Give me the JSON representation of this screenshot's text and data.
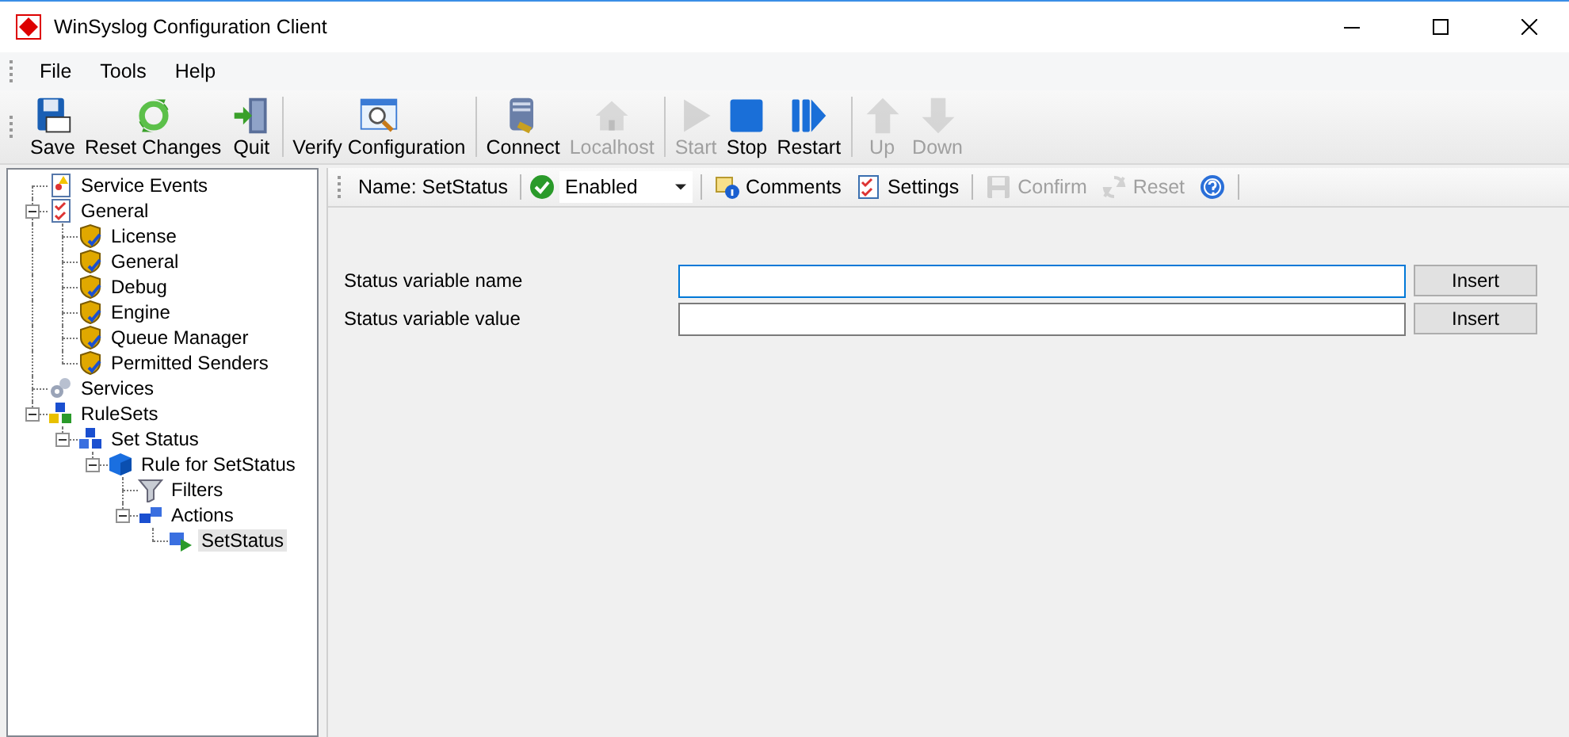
{
  "window": {
    "title": "WinSyslog Configuration Client"
  },
  "menu": [
    {
      "label": "File"
    },
    {
      "label": "Tools"
    },
    {
      "label": "Help"
    }
  ],
  "toolbar": {
    "groups": [
      [
        {
          "kind": "save",
          "label": "Save",
          "disabled": false
        },
        {
          "kind": "reset",
          "label": "Reset Changes",
          "disabled": false
        },
        {
          "kind": "quit",
          "label": "Quit",
          "disabled": false
        }
      ],
      [
        {
          "kind": "verify",
          "label": "Verify Configuration",
          "disabled": false
        }
      ],
      [
        {
          "kind": "connect",
          "label": "Connect",
          "disabled": false
        },
        {
          "kind": "localhost",
          "label": "Localhost",
          "disabled": true
        }
      ],
      [
        {
          "kind": "start",
          "label": "Start",
          "disabled": true
        },
        {
          "kind": "stop",
          "label": "Stop",
          "disabled": false
        },
        {
          "kind": "restart",
          "label": "Restart",
          "disabled": false
        }
      ],
      [
        {
          "kind": "up",
          "label": "Up",
          "disabled": true
        },
        {
          "kind": "down",
          "label": "Down",
          "disabled": true
        }
      ]
    ]
  },
  "tree": [
    {
      "kind": "events",
      "label": "Service Events",
      "selected": false
    },
    {
      "kind": "settings",
      "label": "General",
      "selected": false,
      "expanded": true,
      "children": [
        {
          "kind": "module",
          "label": "License",
          "selected": false
        },
        {
          "kind": "module",
          "label": "General",
          "selected": false
        },
        {
          "kind": "module",
          "label": "Debug",
          "selected": false
        },
        {
          "kind": "module",
          "label": "Engine",
          "selected": false
        },
        {
          "kind": "module",
          "label": "Queue Manager",
          "selected": false
        },
        {
          "kind": "module",
          "label": "Permitted Senders",
          "selected": false
        }
      ]
    },
    {
      "kind": "services",
      "label": "Services",
      "selected": false
    },
    {
      "kind": "rulesets",
      "label": "RuleSets",
      "selected": false,
      "expanded": true,
      "children": [
        {
          "kind": "ruleset",
          "label": "Set Status",
          "selected": false,
          "expanded": true,
          "children": [
            {
              "kind": "rule",
              "label": "Rule for SetStatus",
              "selected": false,
              "expanded": true,
              "children": [
                {
                  "kind": "filters",
                  "label": "Filters",
                  "selected": false
                },
                {
                  "kind": "actions",
                  "label": "Actions",
                  "selected": false,
                  "expanded": true,
                  "children": [
                    {
                      "kind": "action",
                      "label": "SetStatus",
                      "selected": true
                    }
                  ]
                }
              ]
            }
          ]
        }
      ]
    }
  ],
  "rule_bar": {
    "name": "Name: SetStatus",
    "status": "Enabled",
    "groups": [
      [
        {
          "kind": "comments",
          "label": "Comments",
          "disabled": false
        },
        {
          "kind": "settings",
          "label": "Settings",
          "disabled": false
        }
      ],
      [
        {
          "kind": "confirm",
          "label": "Confirm",
          "disabled": true
        },
        {
          "kind": "reset",
          "label": "Reset",
          "disabled": true
        },
        {
          "kind": "help"
        }
      ]
    ]
  },
  "fields": [
    {
      "label": "Status variable name",
      "focused": true,
      "button": "Insert"
    },
    {
      "label": "Status variable value",
      "focused": false,
      "button": "Insert"
    }
  ]
}
